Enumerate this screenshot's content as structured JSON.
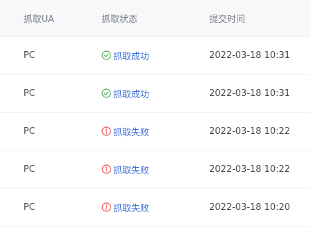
{
  "header": {
    "col_ua": "抓取UA",
    "col_status": "抓取状态",
    "col_time": "提交时间"
  },
  "rows": [
    {
      "ua": "PC",
      "status": "抓取成功",
      "status_type": "success",
      "time": "2022-03-18 10:31"
    },
    {
      "ua": "PC",
      "status": "抓取成功",
      "status_type": "success",
      "time": "2022-03-18 10:31"
    },
    {
      "ua": "PC",
      "status": "抓取失败",
      "status_type": "fail",
      "time": "2022-03-18 10:22"
    },
    {
      "ua": "PC",
      "status": "抓取失败",
      "status_type": "fail",
      "time": "2022-03-18 10:22"
    },
    {
      "ua": "PC",
      "status": "抓取失败",
      "status_type": "fail",
      "time": "2022-03-18 10:20"
    }
  ],
  "colors": {
    "success": "#4caf50",
    "fail": "#f04e4e",
    "link": "#3a70d8"
  },
  "icons": {
    "success": "check-circle-icon",
    "fail": "exclamation-circle-icon"
  }
}
